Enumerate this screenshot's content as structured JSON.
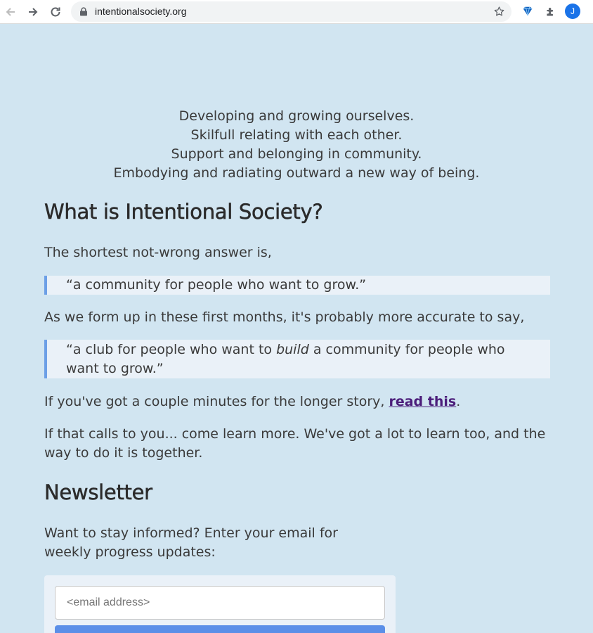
{
  "browser": {
    "url": "intentionalsociety.org",
    "avatar_letter": "J"
  },
  "tagline": [
    "Developing and growing ourselves.",
    "Skilfull relating with each other.",
    "Support and belonging in community.",
    "Embodying and radiating outward a new way of being."
  ],
  "about": {
    "heading": "What is Intentional Society?",
    "intro": "The shortest not-wrong answer is,",
    "quote1": "“a community for people who want to grow.”",
    "bridge": "As we form up in these first months, it's probably more accurate to say,",
    "quote2_pre": "“a club for people who want to ",
    "quote2_em": "build",
    "quote2_post": " a community for people who want to grow.”",
    "story_pre": "If you've got a couple minutes for the longer story, ",
    "story_link": "read this",
    "story_post": ".",
    "calls": "If that calls to you... come learn more. We've got a lot to learn too, and the way to do it is together."
  },
  "newsletter": {
    "heading": "Newsletter",
    "text": "Want to stay informed? Enter your email for weekly progress updates:",
    "email_placeholder": "<email address>"
  },
  "colors": {
    "page_bg": "#d1e5f1",
    "quote_bg": "#eaf1f8",
    "quote_border": "#6c9fe6",
    "link": "#4b1d7a",
    "button": "#5b8fe8"
  },
  "icons": [
    "back-arrow-icon",
    "forward-arrow-icon",
    "reload-icon",
    "lock-icon",
    "star-icon",
    "gem-extension-icon",
    "puzzle-extension-icon"
  ]
}
